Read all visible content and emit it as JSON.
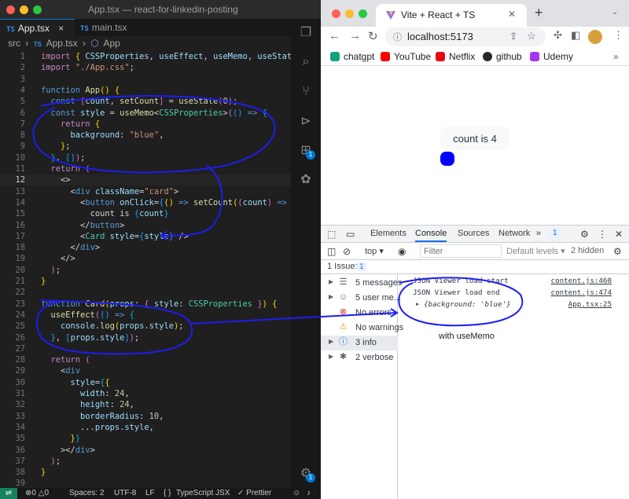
{
  "vscode": {
    "window_title": "App.tsx — react-for-linkedin-posting",
    "tabs": [
      {
        "label": "App.tsx",
        "icon": "TS"
      },
      {
        "label": "main.tsx",
        "icon": "TS"
      }
    ],
    "breadcrumb": {
      "folder": "src",
      "sep": "›",
      "file": "App.tsx",
      "symbol": "App"
    },
    "current_line": 12,
    "status": {
      "errors": "0",
      "warnings": "0",
      "spaces": "Spaces: 2",
      "encoding": "UTF-8",
      "eol": "LF",
      "braces": "{ }",
      "language": "TypeScript JSX",
      "prettier": "✓ Prettier"
    },
    "activity_badge": "1"
  },
  "chrome": {
    "tab_title": "Vite + React + TS",
    "url": "localhost:5173",
    "bookmarks": [
      "chatgpt",
      "YouTube",
      "Netflix",
      "github",
      "Udemy"
    ],
    "page": {
      "button_label": "count is 4",
      "card_color": "#0000ff"
    },
    "devtools": {
      "tabs": [
        "Elements",
        "Console",
        "Sources",
        "Network"
      ],
      "tabs_more": "»",
      "issues_badge": "1",
      "context": "top",
      "filter_placeholder": "Filter",
      "levels": "Default levels ▾",
      "hidden": "2 hidden",
      "issues_bar": "1 Issue:",
      "sidebar": [
        {
          "label": "5 messages"
        },
        {
          "label": "5 user me..."
        },
        {
          "label": "No errors"
        },
        {
          "label": "No warnings"
        },
        {
          "label": "3 info"
        },
        {
          "label": "2 verbose"
        }
      ],
      "console": [
        {
          "text": "JSON Viewer load start",
          "source": "content.js:460"
        },
        {
          "text": "JSON Viewer load end",
          "source": "content.js:474"
        },
        {
          "text": "{background: 'blue'}",
          "source": "App.tsx:25"
        }
      ]
    }
  },
  "annotation": "with useMemo"
}
